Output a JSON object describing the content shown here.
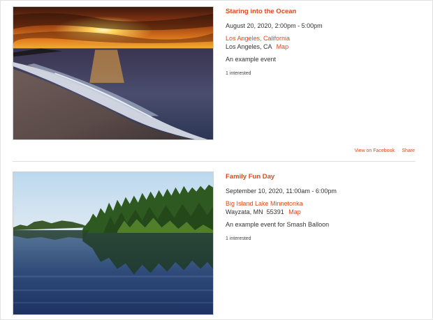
{
  "events": [
    {
      "title": "Staring into the Ocean",
      "date": "August 20, 2020, 2:00pm - 5:00pm",
      "location_name": "Los Angeles, California",
      "address": "Los Angeles, CA",
      "map_label": "Map",
      "description": "An example event",
      "interested": "1 interested",
      "actions": {
        "facebook_label": "View on Facebook",
        "separator": "·",
        "share_label": "Share"
      }
    },
    {
      "title": "Family Fun Day",
      "date": "September 10, 2020, 11:00am - 6:00pm",
      "location_name": "Big Island Lake Minnetonka",
      "address": "Wayzata, MN  55391",
      "map_label": "Map",
      "description": "An example event for Smash Balloon",
      "interested": "1 interested"
    }
  ],
  "colors": {
    "accent": "#dd4a18",
    "text": "#333333",
    "divider": "#dedede"
  }
}
